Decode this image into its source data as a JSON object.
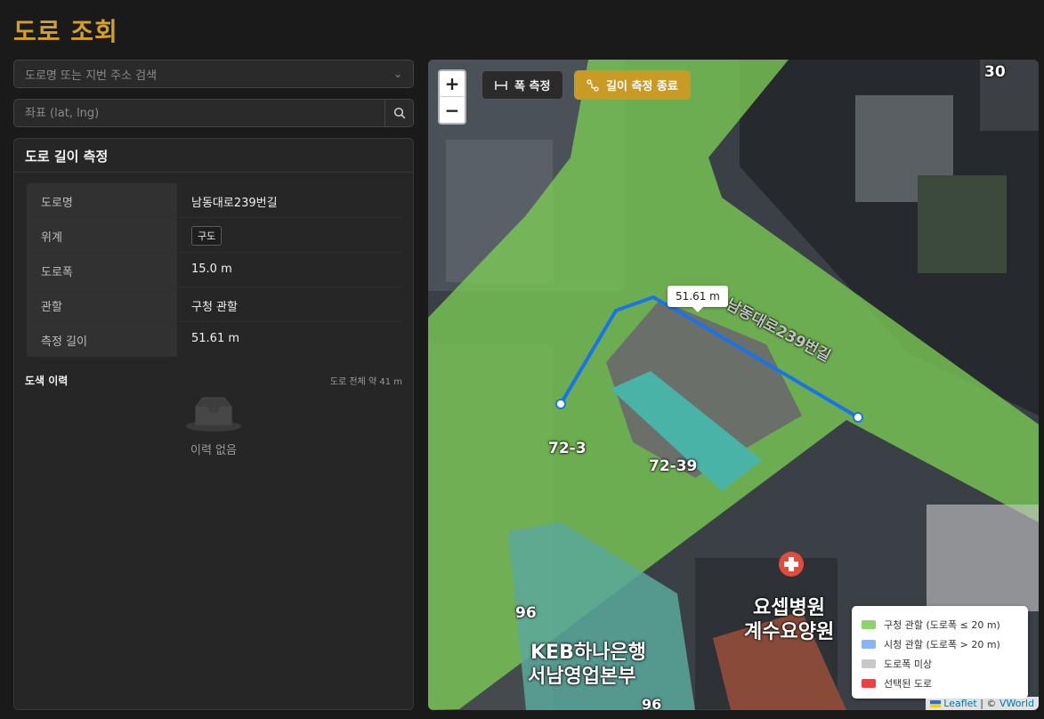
{
  "page": {
    "title": "도로 조회"
  },
  "search": {
    "placeholder": "도로명 또는 지번 주소 검색"
  },
  "coords": {
    "placeholder": "좌표 (lat, lng)"
  },
  "panel": {
    "title": "도로 길이 측정",
    "rows": [
      {
        "key": "도로명",
        "value": "남동대로239번길"
      },
      {
        "key": "위계",
        "value": "구도"
      },
      {
        "key": "도로폭",
        "value": "15.0 m"
      },
      {
        "key": "관할",
        "value": "구청 관할"
      },
      {
        "key": "측정 길이",
        "value": "51.61 m"
      }
    ]
  },
  "history": {
    "title": "도색 이력",
    "total": "도로 전체 약 41 m",
    "empty": "이력 없음"
  },
  "map": {
    "zoom_in": "+",
    "zoom_out": "−",
    "width_tool": "폭 측정",
    "length_tool": "길이 측정 종료",
    "measure_tooltip": "51.61 m",
    "labels": {
      "road": "남동대로239번길",
      "lot_a": "72-3",
      "lot_b": "72-39",
      "lot_c": "96",
      "lot_d": "96",
      "lot_e": "30",
      "hospital1": "요셉병원",
      "hospital2": "계수요양원",
      "bank1": "KEB하나은행",
      "bank2": "서남영업본부"
    },
    "legend": [
      {
        "label": "구청 관할 (도로폭 ≤ 20 m)",
        "color": "#8fd46a"
      },
      {
        "label": "시청 관할 (도로폭 > 20 m)",
        "color": "#8ab4f8"
      },
      {
        "label": "도로폭 미상",
        "color": "#c8c8c8"
      },
      {
        "label": "선택된 도로",
        "color": "#f04040"
      }
    ],
    "attribution": {
      "leaflet": "Leaflet",
      "sep": " | © ",
      "vworld": "VWorld"
    }
  },
  "colors": {
    "accent": "#d4a02a",
    "measure_line": "#1a73e8",
    "jurisdiction_gu": "#8fd46a"
  }
}
